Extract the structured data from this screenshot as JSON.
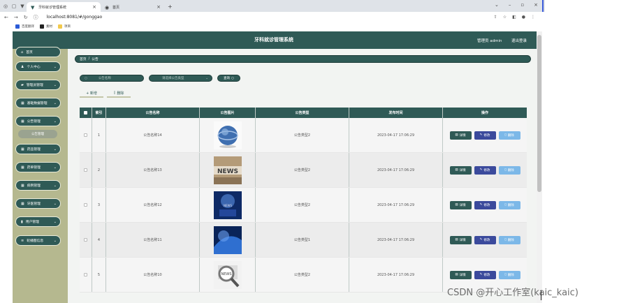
{
  "browser": {
    "tabs": [
      {
        "title": "牙科就诊管理系统",
        "active": true
      },
      {
        "title": "首页",
        "active": false
      }
    ],
    "url": "localhost:8081/#/gonggao",
    "bookmarks": [
      {
        "label": "百度翻译",
        "color": "#2b5bd7"
      },
      {
        "label": "素材",
        "color": "#222222"
      },
      {
        "label": "项目",
        "color": "#f2c94c"
      }
    ]
  },
  "header": {
    "title": "牙科就诊管理系统",
    "admin": "管理员 admin",
    "logout": "退出登录"
  },
  "sidebar": {
    "items": [
      {
        "label": "首页",
        "icon": "home-icon",
        "glyph": "⌂",
        "arrow": false
      },
      {
        "label": "个人中心",
        "icon": "person-icon",
        "glyph": "♟",
        "arrow": true
      },
      {
        "label": "管理员管理",
        "icon": "chat-icon",
        "glyph": "▰",
        "arrow": true
      },
      {
        "label": "基础数据管理",
        "icon": "grid-icon",
        "glyph": "▦",
        "arrow": true
      },
      {
        "label": "公告管理",
        "icon": "grid-icon",
        "glyph": "▦",
        "arrow": true
      },
      {
        "label": "药品管理",
        "icon": "grid-icon",
        "glyph": "▦",
        "arrow": true
      },
      {
        "label": "药单管理",
        "icon": "grid-icon",
        "glyph": "▦",
        "arrow": true
      },
      {
        "label": "病例管理",
        "icon": "grid-icon",
        "glyph": "▦",
        "arrow": true
      },
      {
        "label": "牙医管理",
        "icon": "grid-icon",
        "glyph": "▦",
        "arrow": true
      },
      {
        "label": "用户管理",
        "icon": "user-icon",
        "glyph": "▮",
        "arrow": true
      },
      {
        "label": "轮播图信息",
        "icon": "list-icon",
        "glyph": "≡",
        "arrow": true
      }
    ],
    "subitem": "公告管理"
  },
  "breadcrumb": {
    "home": "首页",
    "sep": "/",
    "current": "公告"
  },
  "search": {
    "name_placeholder": "公告名称",
    "type_placeholder": "请选择公告类型",
    "button": "查询"
  },
  "actions": {
    "add": "+ 新增",
    "delete": "删除"
  },
  "table": {
    "headers": [
      "索引",
      "公告名称",
      "公告图片",
      "公告类型",
      "发布时间",
      "操作"
    ],
    "rows": [
      {
        "index": "1",
        "name": "公告名称14",
        "type": "公告类型2",
        "time": "2023-04-17 17:06:29",
        "img": "globe"
      },
      {
        "index": "2",
        "name": "公告名称13",
        "type": "公告类型2",
        "time": "2023-04-17 17:06:29",
        "img": "news"
      },
      {
        "index": "3",
        "name": "公告名称12",
        "type": "公告类型2",
        "time": "2023-04-17 17:06:29",
        "img": "stage"
      },
      {
        "index": "4",
        "name": "公告名称11",
        "type": "公告类型1",
        "time": "2023-04-17 17:06:29",
        "img": "bluewave"
      },
      {
        "index": "5",
        "name": "公告名称10",
        "type": "公告类型2",
        "time": "2023-04-17 17:06:29",
        "img": "magnifier"
      }
    ],
    "btn_detail": "详情",
    "btn_edit": "修改",
    "btn_delete": "删除"
  },
  "watermark": "CSDN @开心工作室(kaic_kaic)",
  "colors": {
    "primary": "#2f5a56",
    "sidebar": "#b5b88f",
    "edit": "#3b4a9c",
    "delete": "#7cb8e8"
  }
}
